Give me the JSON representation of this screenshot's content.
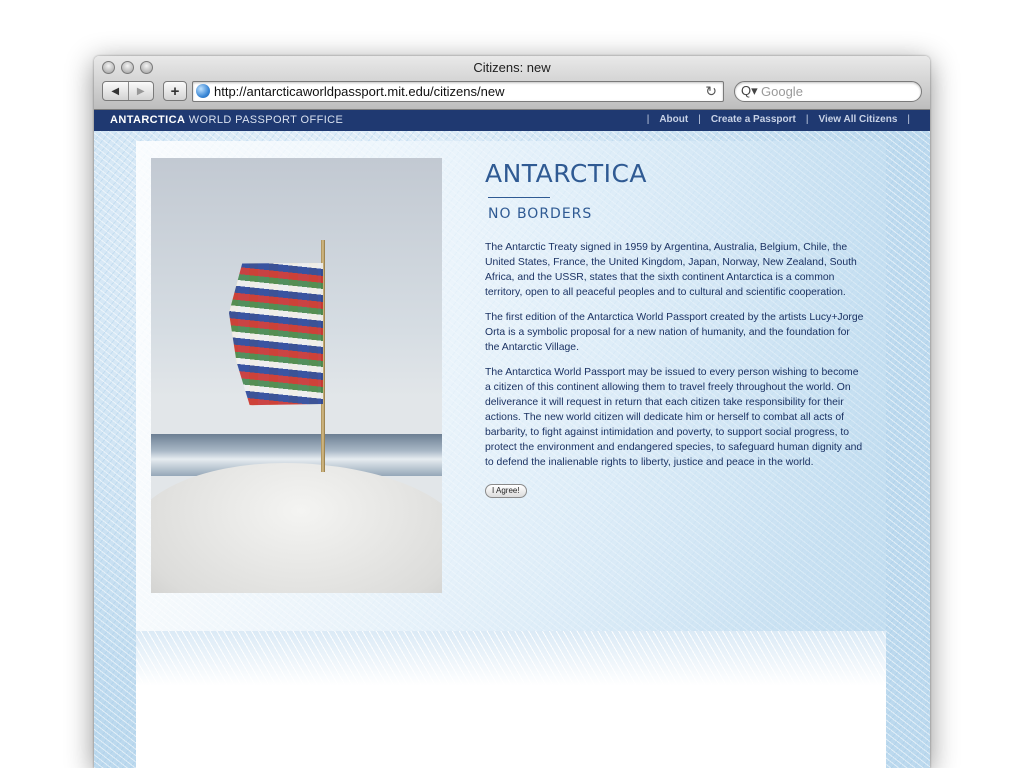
{
  "window": {
    "title": "Citizens: new"
  },
  "browser": {
    "url": "http://antarcticaworldpassport.mit.edu/citizens/new",
    "search_placeholder": "Google",
    "back_glyph": "◀",
    "forward_glyph": "▶",
    "add_glyph": "+",
    "reload_glyph": "↻",
    "search_glyph": "Q▾"
  },
  "site": {
    "logo_bold": "ANTARCTICA",
    "logo_rest": " WORLD PASSPORT OFFICE",
    "nav": [
      "About",
      "Create a Passport",
      "View All Citizens"
    ],
    "nav_separator": "|"
  },
  "main": {
    "heading": "ANTARCTICA",
    "subheading": "NO BORDERS",
    "paragraphs": [
      "The Antarctic Treaty signed in 1959 by Argentina, Australia, Belgium, Chile, the United States, France, the United Kingdom, Japan, Norway, New Zealand, South Africa, and the USSR, states that the sixth continent Antarctica is a common territory, open to all peaceful peoples and to cultural and scientific cooperation.",
      "The first edition of the Antarctica World Passport created by the artists Lucy+Jorge Orta is a symbolic proposal for a new nation of humanity, and the foundation for the Antarctic Village.",
      "The Antarctica World Passport may be issued to every person wishing to become a citizen of this continent allowing them to travel freely throughout the world. On deliverance it will request in return that each citizen take responsibility for their actions. The new world citizen will dedicate him or herself to combat all acts of barbarity, to fight against intimidation and poverty, to support social progress, to protect the environment and endangered species, to safeguard human dignity and to defend the inalienable rights to liberty, justice and peace in the world."
    ],
    "agree_button": "I Agree!"
  },
  "colors": {
    "sitebar": "#1f3971",
    "heading": "#2f5a93",
    "body_text": "#1b3263"
  }
}
